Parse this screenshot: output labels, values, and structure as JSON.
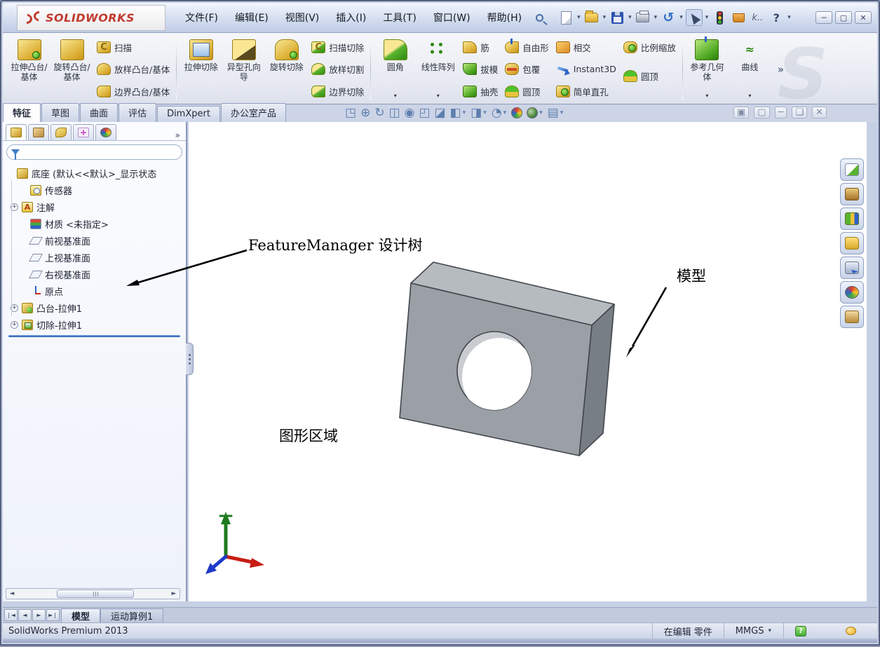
{
  "titlebar": {
    "logo": "SOLIDWORKS",
    "menus": [
      "文件(F)",
      "编辑(E)",
      "视图(V)",
      "插入(I)",
      "工具(T)",
      "窗口(W)",
      "帮助(H)"
    ],
    "quick_tool_icons": [
      "new-document-icon",
      "open-icon",
      "save-icon",
      "print-icon",
      "undo-icon",
      "select-cursor-icon",
      "rebuild-traffic-light-icon",
      "file-properties-icon",
      "quick-tools-icon",
      "help-icon"
    ],
    "window_controls": [
      "minimize-icon",
      "restore-icon",
      "close-icon"
    ]
  },
  "ribbon": {
    "overflow": "»",
    "groups": [
      {
        "big": [
          {
            "label": "拉伸凸台/基体",
            "icon": "extrude-boss-icon"
          },
          {
            "label": "旋转凸台/基体",
            "icon": "revolve-boss-icon"
          }
        ],
        "stacks": [
          [
            {
              "label": "扫描",
              "icon": "sweep-icon"
            },
            {
              "label": "放样凸台/基体",
              "icon": "loft-icon"
            },
            {
              "label": "边界凸台/基体",
              "icon": "boundary-boss-icon"
            }
          ]
        ]
      },
      {
        "big": [
          {
            "label": "拉伸切除",
            "icon": "extruded-cut-icon"
          },
          {
            "label": "异型孔向导",
            "icon": "hole-wizard-icon"
          },
          {
            "label": "旋转切除",
            "icon": "revolved-cut-icon"
          }
        ],
        "stacks": [
          [
            {
              "label": "扫描切除",
              "icon": "swept-cut-icon"
            },
            {
              "label": "放样切割",
              "icon": "lofted-cut-icon"
            },
            {
              "label": "边界切除",
              "icon": "boundary-cut-icon"
            }
          ]
        ]
      },
      {
        "big": [
          {
            "label": "圆角",
            "icon": "fillet-icon"
          },
          {
            "label": "线性阵列",
            "icon": "linear-pattern-icon"
          }
        ],
        "stacks": [
          [
            {
              "label": "筋",
              "icon": "rib-icon"
            },
            {
              "label": "拔模",
              "icon": "draft-icon"
            },
            {
              "label": "抽壳",
              "icon": "shell-icon"
            }
          ],
          [
            {
              "label": "自由形",
              "icon": "freeform-icon"
            },
            {
              "label": "包覆",
              "icon": "wrap-icon"
            },
            {
              "label": "圆顶",
              "icon": "dome-icon"
            }
          ],
          [
            {
              "label": "相交",
              "icon": "intersect-icon"
            },
            {
              "label": "Instant3D",
              "icon": "instant3d-icon"
            },
            {
              "label": "简单直孔",
              "icon": "simple-hole-icon"
            }
          ],
          [
            {
              "label": "比例缩放",
              "icon": "scale-icon"
            },
            {
              "label": "圆顶",
              "icon": "dome-icon"
            }
          ]
        ]
      },
      {
        "big": [
          {
            "label": "参考几何体",
            "icon": "reference-geometry-icon"
          },
          {
            "label": "曲线",
            "icon": "curves-icon"
          }
        ]
      }
    ]
  },
  "command_tabs": [
    "特征",
    "草图",
    "曲面",
    "评估",
    "DimXpert",
    "办公室产品"
  ],
  "headsup_icons": [
    "zoom-fit-icon",
    "pan-icon",
    "rotate-view-icon",
    "section-view-icon",
    "zoom-in-icon",
    "zoom-area-icon",
    "view-selector-icon",
    "view-orientation-icon",
    "display-style-icon",
    "hide-show-items-icon",
    "edit-appearance-icon",
    "apply-scene-icon",
    "view-settings-icon"
  ],
  "doc_window_controls": [
    "doc-tile-icon",
    "doc-cascade-icon",
    "doc-minimize-icon",
    "doc-restore-icon",
    "doc-close-icon"
  ],
  "feature_manager": {
    "tab_icons": [
      "featuremanager-tab-icon",
      "propertymanager-tab-icon",
      "configurationmanager-tab-icon",
      "dimxpertmanager-tab-icon",
      "displaymanager-tab-icon"
    ],
    "root": "底座 (默认<<默认>_显示状态",
    "items": [
      {
        "label": "传感器",
        "icon": "sensors-icon",
        "expandable": false
      },
      {
        "label": "注解",
        "icon": "annotations-icon",
        "expandable": true
      },
      {
        "label": "材质 <未指定>",
        "icon": "material-icon",
        "expandable": false
      },
      {
        "label": "前视基准面",
        "icon": "plane-icon",
        "expandable": false
      },
      {
        "label": "上视基准面",
        "icon": "plane-icon",
        "expandable": false
      },
      {
        "label": "右视基准面",
        "icon": "plane-icon",
        "expandable": false
      },
      {
        "label": "原点",
        "icon": "origin-icon",
        "expandable": false
      },
      {
        "label": "凸台-拉伸1",
        "icon": "boss-extrude-icon",
        "expandable": true
      },
      {
        "label": "切除-拉伸1",
        "icon": "cut-extrude-icon",
        "expandable": true
      }
    ]
  },
  "task_pane_icons": [
    "solidworks-resources-icon",
    "design-library-icon",
    "toolbox-icon",
    "file-explorer-icon",
    "view-palette-icon",
    "appearances-icon",
    "custom-properties-icon"
  ],
  "annotations": {
    "design_tree": "FeatureManager 设计树",
    "model": "模型",
    "graphics_area": "图形区域"
  },
  "bottom_tabs": {
    "nav_icons": [
      "first-tab-icon",
      "prev-tab-icon",
      "next-tab-icon",
      "last-tab-icon"
    ],
    "tabs": [
      "模型",
      "运动算例1"
    ]
  },
  "status_bar": {
    "left": "SolidWorks Premium 2013",
    "editing": "在编辑 零件",
    "units": "MMGS"
  },
  "colors": {
    "accent_gold": "#d9a72c",
    "accent_green": "#3fae3a",
    "model_front": "#9aa0a6",
    "model_top": "#b6bbc0",
    "model_right": "#787e85",
    "rollback_blue": "#2a5ca8"
  }
}
